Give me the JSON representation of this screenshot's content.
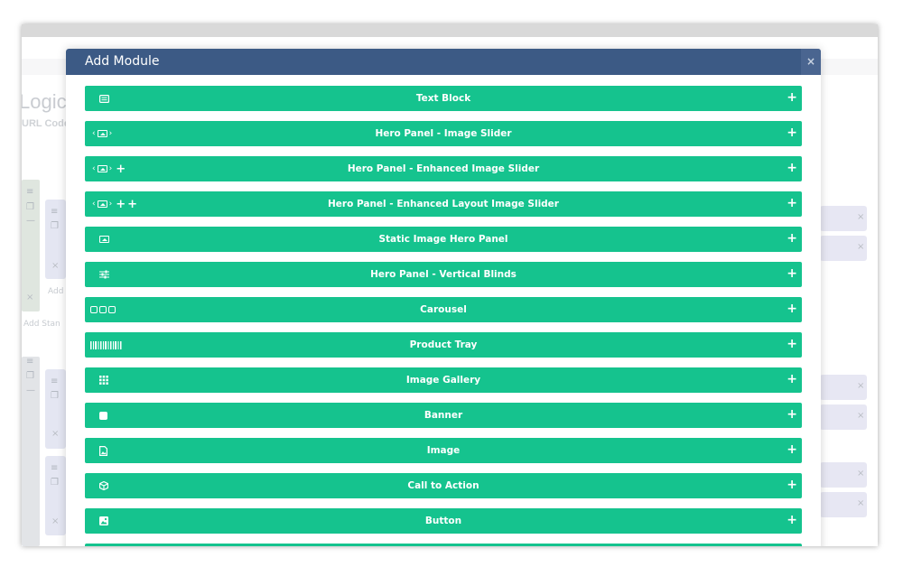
{
  "background": {
    "heading": "Logic",
    "subheading": "URL Code:",
    "add_link": "Add",
    "add_standard_link": "Add Stan"
  },
  "modal": {
    "title": "Add Module",
    "close_label": "×",
    "modules": [
      {
        "label": "Text Block",
        "icon": "text-block-icon"
      },
      {
        "label": "Hero Panel - Image Slider",
        "icon": "image-slider-icon"
      },
      {
        "label": "Hero Panel - Enhanced Image Slider",
        "icon": "enhanced-image-slider-icon"
      },
      {
        "label": "Hero Panel - Enhanced Layout Image Slider",
        "icon": "enhanced-layout-slider-icon"
      },
      {
        "label": "Static Image Hero Panel",
        "icon": "static-image-icon"
      },
      {
        "label": "Hero Panel - Vertical Blinds",
        "icon": "sliders-icon"
      },
      {
        "label": "Carousel",
        "icon": "carousel-icon"
      },
      {
        "label": "Product Tray",
        "icon": "barcode-icon"
      },
      {
        "label": "Image Gallery",
        "icon": "grid-icon"
      },
      {
        "label": "Banner",
        "icon": "square-icon"
      },
      {
        "label": "Image",
        "icon": "image-file-icon"
      },
      {
        "label": "Call to Action",
        "icon": "cube-icon"
      },
      {
        "label": "Button",
        "icon": "picture-icon"
      }
    ],
    "add_symbol": "+"
  },
  "colors": {
    "header": "#3c5a85",
    "module_row": "#15c38e"
  }
}
